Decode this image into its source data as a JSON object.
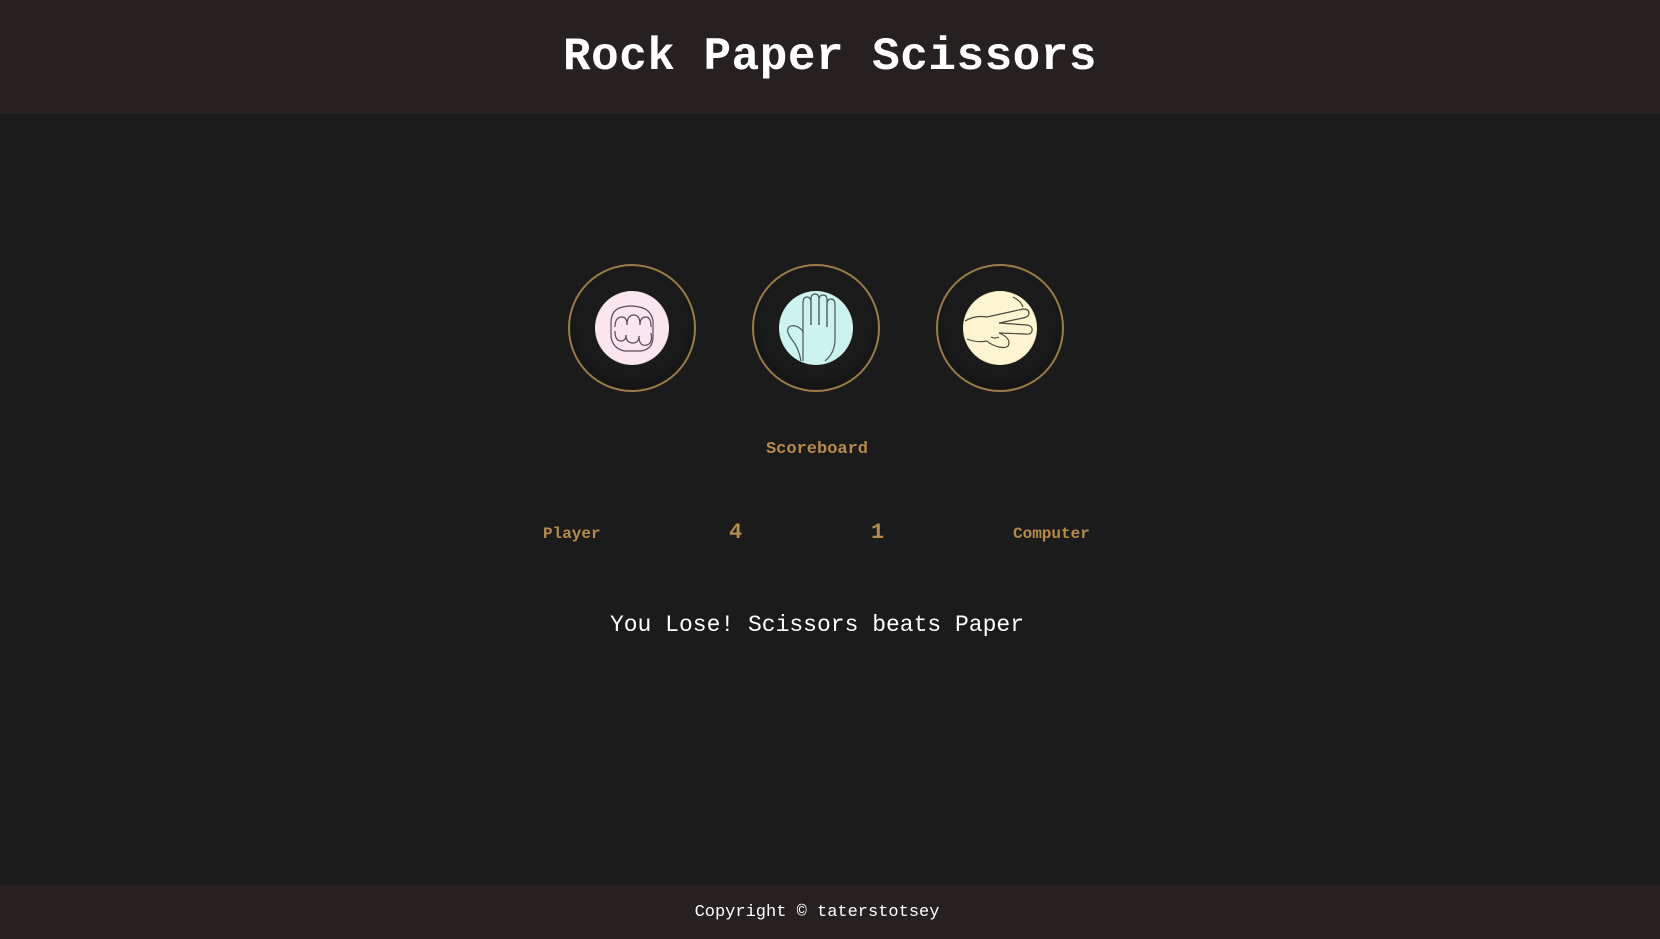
{
  "header": {
    "title": "Rock Paper Scissors"
  },
  "choices": [
    {
      "name": "rock",
      "icon": "rock-fist-icon",
      "color": "#fbe5ef"
    },
    {
      "name": "paper",
      "icon": "paper-hand-icon",
      "color": "#cdf3ef"
    },
    {
      "name": "scissors",
      "icon": "scissors-hand-icon",
      "color": "#fdf4d1"
    }
  ],
  "scoreboard": {
    "title": "Scoreboard",
    "player_label": "Player",
    "player_score": "4",
    "computer_score": "1",
    "computer_label": "Computer"
  },
  "result": "You Lose! Scissors beats Paper",
  "footer": {
    "copyright": "Copyright © taterstotsey"
  },
  "colors": {
    "accent": "#b58a4d",
    "ring": "#9c7b48",
    "background": "#1b1b1b",
    "bar": "#262020"
  }
}
